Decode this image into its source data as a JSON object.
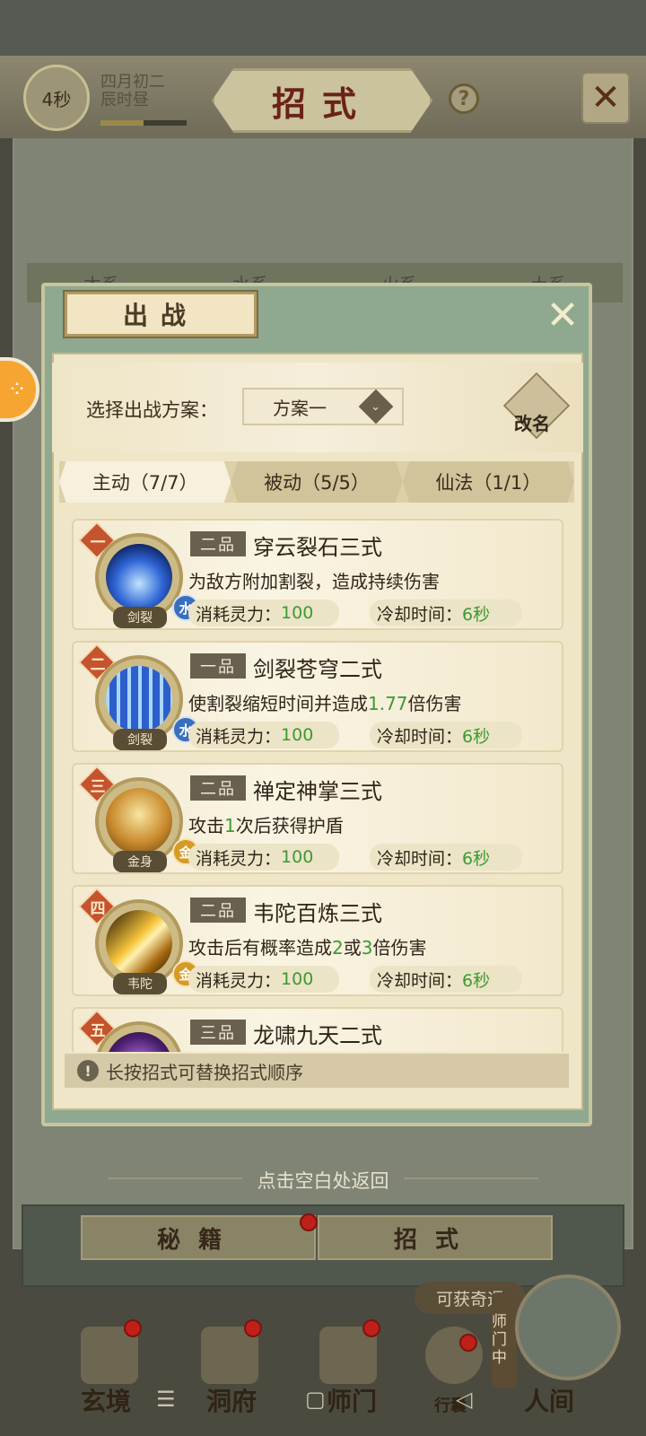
{
  "header": {
    "timer": "4秒",
    "date_line1": "四月初二",
    "date_line2": "辰时昼",
    "title": "招式",
    "help_icon": "?",
    "close_icon": "✕"
  },
  "background_tabs": [
    "木系",
    "水系",
    "火系",
    "土系"
  ],
  "dialog": {
    "title": "出战",
    "close_icon": "✕",
    "scheme_label": "选择出战方案：",
    "scheme_value": "方案一",
    "rename_label": "改名",
    "tabs": [
      {
        "label": "主动（7/7）",
        "active": true
      },
      {
        "label": "被动（5/5）",
        "active": false
      },
      {
        "label": "仙法（1/1）",
        "active": false
      }
    ],
    "cost_label": "消耗灵力：",
    "cooldown_label": "冷却时间：",
    "skills": [
      {
        "rank": "一",
        "grade": "二品",
        "name": "穿云裂石三式",
        "desc": "为敌方附加割裂，造成持续伤害",
        "desc_parts": [
          "为敌方附加割裂，造成持续伤害"
        ],
        "icon_label": "剑裂",
        "element": "水",
        "cost": "100",
        "cooldown": "6秒",
        "icon": "blue-sword-skill-icon"
      },
      {
        "rank": "二",
        "grade": "一品",
        "name": "剑裂苍穹二式",
        "desc_parts": [
          "使割裂缩短时间并造成",
          "1.77",
          "倍伤害"
        ],
        "icon_label": "剑裂",
        "element": "水",
        "cost": "100",
        "cooldown": "6秒",
        "icon": "blue-sword-rain-icon"
      },
      {
        "rank": "三",
        "grade": "二品",
        "name": "禅定神掌三式",
        "desc_parts": [
          "攻击",
          "1",
          "次后获得护盾"
        ],
        "icon_label": "金身",
        "element": "金",
        "cost": "100",
        "cooldown": "6秒",
        "icon": "meditating-monk-icon"
      },
      {
        "rank": "四",
        "grade": "二品",
        "name": "韦陀百炼三式",
        "desc_parts": [
          "攻击后有概率造成",
          "2",
          "或",
          "3",
          "倍伤害"
        ],
        "icon_label": "韦陀",
        "element": "金",
        "cost": "100",
        "cooldown": "6秒",
        "icon": "golden-pestle-icon"
      },
      {
        "rank": "五",
        "grade": "三品",
        "name": "龙啸九天二式",
        "desc_parts": [],
        "icon_label": "",
        "element": "",
        "cost": "",
        "cooldown": "",
        "icon": "purple-dragon-icon"
      }
    ],
    "hint": "长按招式可替换招式顺序"
  },
  "back_hint": "点击空白处返回",
  "subtabs": [
    "秘籍",
    "招式"
  ],
  "reward_badge": "可获奇遇",
  "master_badge": "师门中",
  "bottom_nav": [
    "玄境",
    "洞府",
    "师门",
    "行囊",
    "人间"
  ],
  "system_nav": [
    "☰",
    "▢",
    "◁"
  ],
  "colors": {
    "highlight_green": "#3c9a34",
    "rank_red": "#c5532e",
    "water_blue": "#3a6fc0",
    "metal_gold": "#d59a28"
  }
}
